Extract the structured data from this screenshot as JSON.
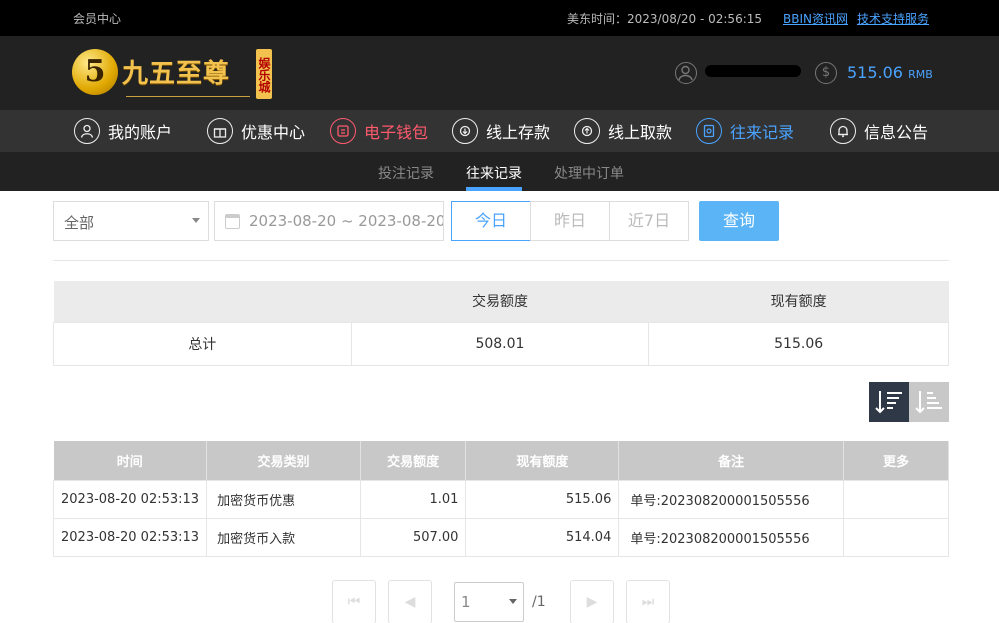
{
  "topbar": {
    "member_center": "会员中心",
    "time_label": "美东时间：2023/08/20 - 02:56:15",
    "links": [
      "BBIN资讯网",
      "技术支持服务"
    ]
  },
  "logo": {
    "mark": "5",
    "name": "九五至尊",
    "sub": "娱乐城"
  },
  "user": {
    "name": "",
    "balance": "515.06",
    "currency": "RMB"
  },
  "nav": {
    "items": [
      {
        "label": "我的账户",
        "icon": "user-icon"
      },
      {
        "label": "优惠中心",
        "icon": "gift-icon"
      },
      {
        "label": "电子钱包",
        "icon": "wallet-icon"
      },
      {
        "label": "线上存款",
        "icon": "deposit-icon"
      },
      {
        "label": "线上取款",
        "icon": "withdraw-icon"
      },
      {
        "label": "往来记录",
        "icon": "record-icon"
      },
      {
        "label": "信息公告",
        "icon": "bell-icon"
      }
    ]
  },
  "subnav": {
    "items": [
      "投注记录",
      "往来记录",
      "处理中订单"
    ]
  },
  "filters": {
    "type_select": "全部",
    "date_range": "2023-08-20 ~ 2023-08-20",
    "quick": [
      "今日",
      "昨日",
      "近7日"
    ],
    "query_label": "查询"
  },
  "summary": {
    "headers": [
      "",
      "交易额度",
      "现有额度"
    ],
    "row": [
      "总计",
      "508.01",
      "515.06"
    ]
  },
  "records": {
    "headers": [
      "时间",
      "交易类别",
      "交易额度",
      "现有额度",
      "备注",
      "更多"
    ],
    "rows": [
      [
        "2023-08-20 02:53:13",
        "加密货币优惠",
        "1.01",
        "515.06",
        "单号:202308200001505556",
        ""
      ],
      [
        "2023-08-20 02:53:13",
        "加密货币入款",
        "507.00",
        "514.04",
        "单号:202308200001505556",
        ""
      ]
    ]
  },
  "pagination": {
    "first": "⏮",
    "prev": "◀",
    "page": "1",
    "total": "/1",
    "next": "▶",
    "last": "⏭"
  },
  "colors": {
    "accent": "#4aa3ff",
    "wallet": "#ff5a6e",
    "query_button": "#5bb4f5"
  }
}
